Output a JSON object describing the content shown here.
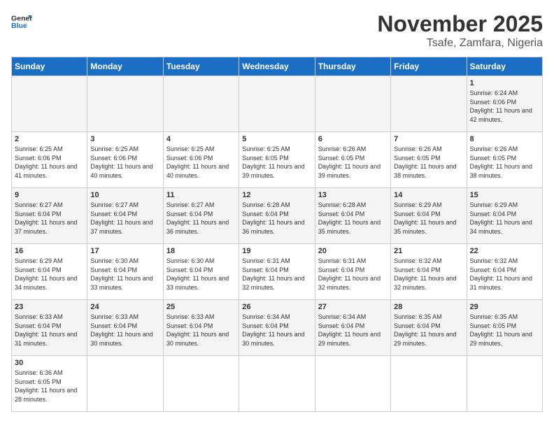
{
  "logo": {
    "general": "General",
    "blue": "Blue"
  },
  "title": "November 2025",
  "location": "Tsafe, Zamfara, Nigeria",
  "weekdays": [
    "Sunday",
    "Monday",
    "Tuesday",
    "Wednesday",
    "Thursday",
    "Friday",
    "Saturday"
  ],
  "weeks": [
    [
      {
        "day": "",
        "info": ""
      },
      {
        "day": "",
        "info": ""
      },
      {
        "day": "",
        "info": ""
      },
      {
        "day": "",
        "info": ""
      },
      {
        "day": "",
        "info": ""
      },
      {
        "day": "",
        "info": ""
      },
      {
        "day": "1",
        "info": "Sunrise: 6:24 AM\nSunset: 6:06 PM\nDaylight: 11 hours\nand 42 minutes."
      }
    ],
    [
      {
        "day": "2",
        "info": "Sunrise: 6:25 AM\nSunset: 6:06 PM\nDaylight: 11 hours\nand 41 minutes."
      },
      {
        "day": "3",
        "info": "Sunrise: 6:25 AM\nSunset: 6:06 PM\nDaylight: 11 hours\nand 40 minutes."
      },
      {
        "day": "4",
        "info": "Sunrise: 6:25 AM\nSunset: 6:06 PM\nDaylight: 11 hours\nand 40 minutes."
      },
      {
        "day": "5",
        "info": "Sunrise: 6:25 AM\nSunset: 6:05 PM\nDaylight: 11 hours\nand 39 minutes."
      },
      {
        "day": "6",
        "info": "Sunrise: 6:26 AM\nSunset: 6:05 PM\nDaylight: 11 hours\nand 39 minutes."
      },
      {
        "day": "7",
        "info": "Sunrise: 6:26 AM\nSunset: 6:05 PM\nDaylight: 11 hours\nand 38 minutes."
      },
      {
        "day": "8",
        "info": "Sunrise: 6:26 AM\nSunset: 6:05 PM\nDaylight: 11 hours\nand 38 minutes."
      }
    ],
    [
      {
        "day": "9",
        "info": "Sunrise: 6:27 AM\nSunset: 6:04 PM\nDaylight: 11 hours\nand 37 minutes."
      },
      {
        "day": "10",
        "info": "Sunrise: 6:27 AM\nSunset: 6:04 PM\nDaylight: 11 hours\nand 37 minutes."
      },
      {
        "day": "11",
        "info": "Sunrise: 6:27 AM\nSunset: 6:04 PM\nDaylight: 11 hours\nand 36 minutes."
      },
      {
        "day": "12",
        "info": "Sunrise: 6:28 AM\nSunset: 6:04 PM\nDaylight: 11 hours\nand 36 minutes."
      },
      {
        "day": "13",
        "info": "Sunrise: 6:28 AM\nSunset: 6:04 PM\nDaylight: 11 hours\nand 35 minutes."
      },
      {
        "day": "14",
        "info": "Sunrise: 6:29 AM\nSunset: 6:04 PM\nDaylight: 11 hours\nand 35 minutes."
      },
      {
        "day": "15",
        "info": "Sunrise: 6:29 AM\nSunset: 6:04 PM\nDaylight: 11 hours\nand 34 minutes."
      }
    ],
    [
      {
        "day": "16",
        "info": "Sunrise: 6:29 AM\nSunset: 6:04 PM\nDaylight: 11 hours\nand 34 minutes."
      },
      {
        "day": "17",
        "info": "Sunrise: 6:30 AM\nSunset: 6:04 PM\nDaylight: 11 hours\nand 33 minutes."
      },
      {
        "day": "18",
        "info": "Sunrise: 6:30 AM\nSunset: 6:04 PM\nDaylight: 11 hours\nand 33 minutes."
      },
      {
        "day": "19",
        "info": "Sunrise: 6:31 AM\nSunset: 6:04 PM\nDaylight: 11 hours\nand 32 minutes."
      },
      {
        "day": "20",
        "info": "Sunrise: 6:31 AM\nSunset: 6:04 PM\nDaylight: 11 hours\nand 32 minutes."
      },
      {
        "day": "21",
        "info": "Sunrise: 6:32 AM\nSunset: 6:04 PM\nDaylight: 11 hours\nand 32 minutes."
      },
      {
        "day": "22",
        "info": "Sunrise: 6:32 AM\nSunset: 6:04 PM\nDaylight: 11 hours\nand 31 minutes."
      }
    ],
    [
      {
        "day": "23",
        "info": "Sunrise: 6:33 AM\nSunset: 6:04 PM\nDaylight: 11 hours\nand 31 minutes."
      },
      {
        "day": "24",
        "info": "Sunrise: 6:33 AM\nSunset: 6:04 PM\nDaylight: 11 hours\nand 30 minutes."
      },
      {
        "day": "25",
        "info": "Sunrise: 6:33 AM\nSunset: 6:04 PM\nDaylight: 11 hours\nand 30 minutes."
      },
      {
        "day": "26",
        "info": "Sunrise: 6:34 AM\nSunset: 6:04 PM\nDaylight: 11 hours\nand 30 minutes."
      },
      {
        "day": "27",
        "info": "Sunrise: 6:34 AM\nSunset: 6:04 PM\nDaylight: 11 hours\nand 29 minutes."
      },
      {
        "day": "28",
        "info": "Sunrise: 6:35 AM\nSunset: 6:04 PM\nDaylight: 11 hours\nand 29 minutes."
      },
      {
        "day": "29",
        "info": "Sunrise: 6:35 AM\nSunset: 6:05 PM\nDaylight: 11 hours\nand 29 minutes."
      }
    ],
    [
      {
        "day": "30",
        "info": "Sunrise: 6:36 AM\nSunset: 6:05 PM\nDaylight: 11 hours\nand 28 minutes."
      },
      {
        "day": "",
        "info": ""
      },
      {
        "day": "",
        "info": ""
      },
      {
        "day": "",
        "info": ""
      },
      {
        "day": "",
        "info": ""
      },
      {
        "day": "",
        "info": ""
      },
      {
        "day": "",
        "info": ""
      }
    ]
  ]
}
